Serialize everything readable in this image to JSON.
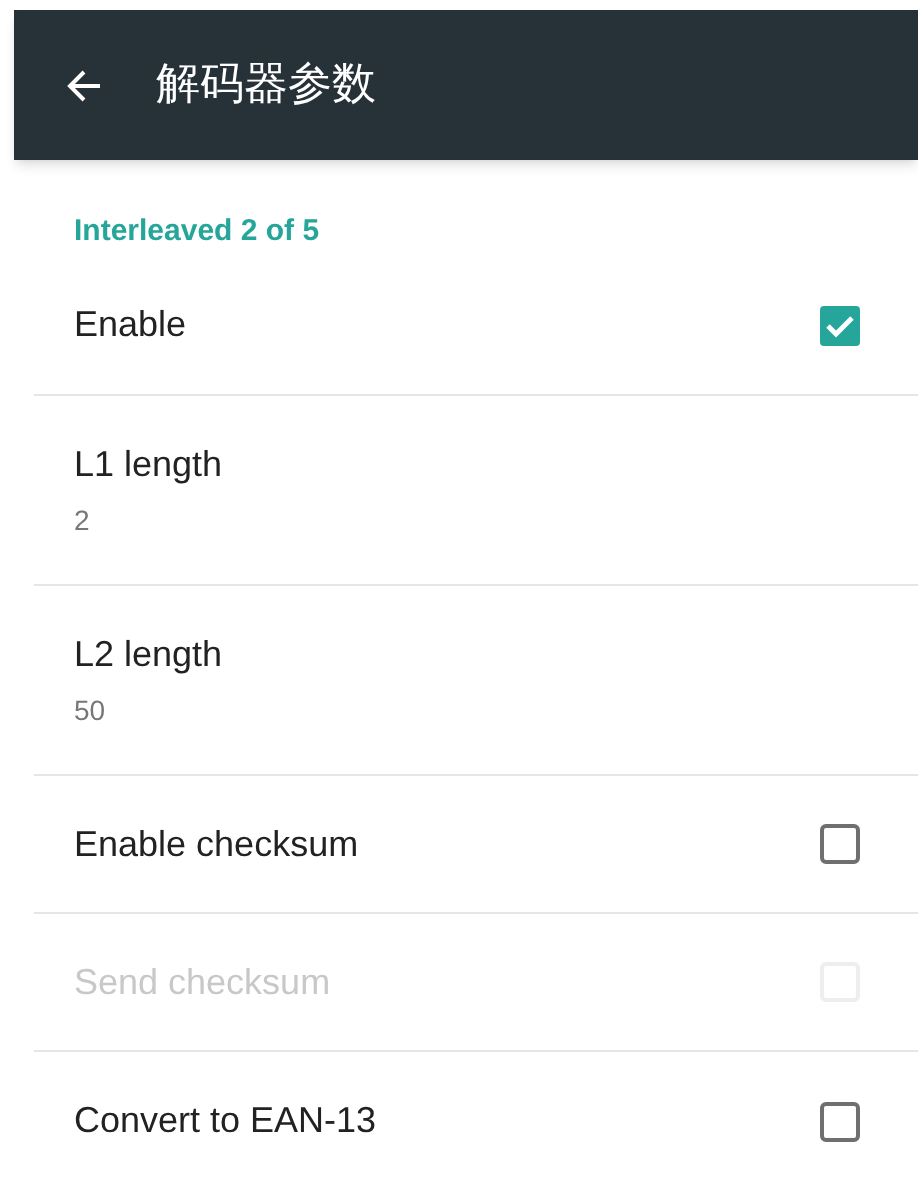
{
  "app_bar": {
    "title": "解码器参数"
  },
  "section": {
    "title": "Interleaved 2 of 5"
  },
  "items": [
    {
      "kind": "checkbox",
      "label": "Enable",
      "checked": true,
      "disabled": false
    },
    {
      "kind": "value",
      "label": "L1 length",
      "value": "2"
    },
    {
      "kind": "value",
      "label": "L2 length",
      "value": "50"
    },
    {
      "kind": "checkbox",
      "label": "Enable checksum",
      "checked": false,
      "disabled": false
    },
    {
      "kind": "checkbox",
      "label": "Send checksum",
      "checked": false,
      "disabled": true
    },
    {
      "kind": "checkbox",
      "label": "Convert to EAN-13",
      "checked": false,
      "disabled": false
    }
  ]
}
